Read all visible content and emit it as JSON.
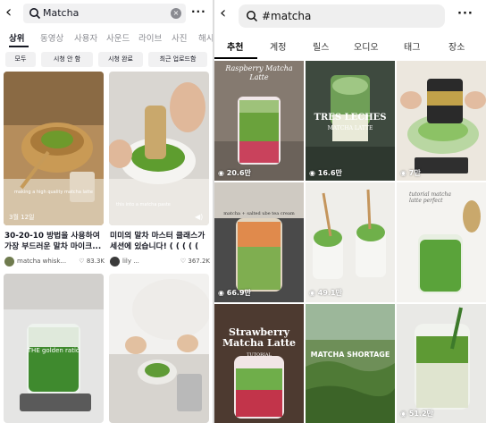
{
  "left": {
    "search": {
      "query": "Matcha"
    },
    "tabs": [
      "상위",
      "동영상",
      "사용자",
      "사운드",
      "라이브",
      "사진",
      "해시"
    ],
    "filters": [
      "모두",
      "시청 안 함",
      "시청 완료",
      "최근 업로드함"
    ],
    "cards": [
      {
        "overlay": "making a high quality matcha latte",
        "date": "3월 12일",
        "caption_line1": "30-20-10 방법을 사용하여",
        "caption_line2": "가장 부드러운 말차 마이크...",
        "author": "matcha whisk...",
        "likes": "83.3K"
      },
      {
        "overlay": "this into a matcha paste",
        "caption_line1": "미미의 말차 마스터 클래스가",
        "caption_line2": "세션에 있습니다! ( ( ( ( (",
        "author": "lily ...",
        "likes": "367.2K"
      },
      {
        "overlay": "THE golden ratio"
      },
      {
        "overlay": ""
      }
    ]
  },
  "right": {
    "search": {
      "query": "#matcha"
    },
    "tabs": [
      "추천",
      "계정",
      "릴스",
      "오디오",
      "태그",
      "장소"
    ],
    "tiles": [
      {
        "title": "Raspberry Matcha Latte",
        "views": "20.6만"
      },
      {
        "title": "TRES LECHES",
        "subtitle": "MATCHA LATTE",
        "views": "16.6만"
      },
      {
        "title": "",
        "views": "7만"
      },
      {
        "title": "matcha + salted ube tea cream",
        "views": "66.9만"
      },
      {
        "title": "",
        "views": "49.1만"
      },
      {
        "title": "tutorial matcha latte perfect",
        "views": ""
      },
      {
        "title": "Strawberry Matcha Latte",
        "subtitle": "TUTORIAL",
        "views": ""
      },
      {
        "title": "MATCHA SHORTAGE",
        "views": ""
      },
      {
        "title": "",
        "views": "51.2만"
      }
    ]
  },
  "colors": {
    "matcha": "#5a9a3a",
    "matcha_light": "#8fc06a",
    "accent_dark": "#161823"
  }
}
